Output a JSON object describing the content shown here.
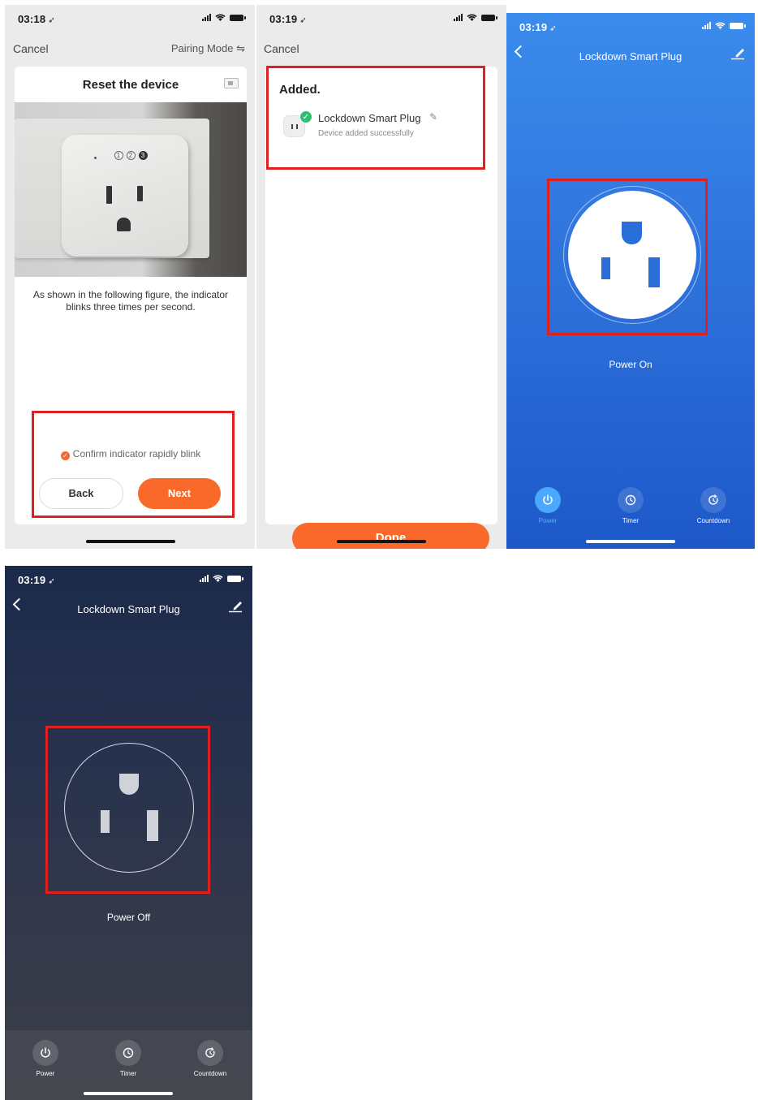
{
  "colors": {
    "accent_orange": "#f96a2a",
    "success_green": "#2fbf71",
    "highlight_red": "#e02020",
    "on_blue": "#2f74dd",
    "off_navy": "#1c2a4a"
  },
  "screen1": {
    "status": {
      "time": "03:18",
      "arrow": "➶"
    },
    "nav": {
      "cancel": "Cancel",
      "pairing_mode": "Pairing Mode ⇋"
    },
    "title": "Reset the device",
    "steps": [
      "1",
      "2",
      "3"
    ],
    "active_step": 3,
    "instruction": "As shown in the following figure, the indicator blinks three times per second.",
    "confirm_label": "Confirm indicator rapidly blink",
    "back_label": "Back",
    "next_label": "Next"
  },
  "screen2": {
    "status": {
      "time": "03:19",
      "arrow": "➶"
    },
    "nav": {
      "cancel": "Cancel"
    },
    "added_title": "Added.",
    "device_name": "Lockdown Smart Plug",
    "device_status": "Device added successfully",
    "done_label": "Done"
  },
  "screen3": {
    "status": {
      "time": "03:19",
      "arrow": "➶"
    },
    "title": "Lockdown Smart Plug",
    "state_label": "Power On",
    "tabs": {
      "power": "Power",
      "timer": "Timer",
      "countdown": "Countdown"
    }
  },
  "screen4": {
    "status": {
      "time": "03:19",
      "arrow": "➶"
    },
    "title": "Lockdown Smart Plug",
    "state_label": "Power Off",
    "tabs": {
      "power": "Power",
      "timer": "Timer",
      "countdown": "Countdown"
    }
  }
}
